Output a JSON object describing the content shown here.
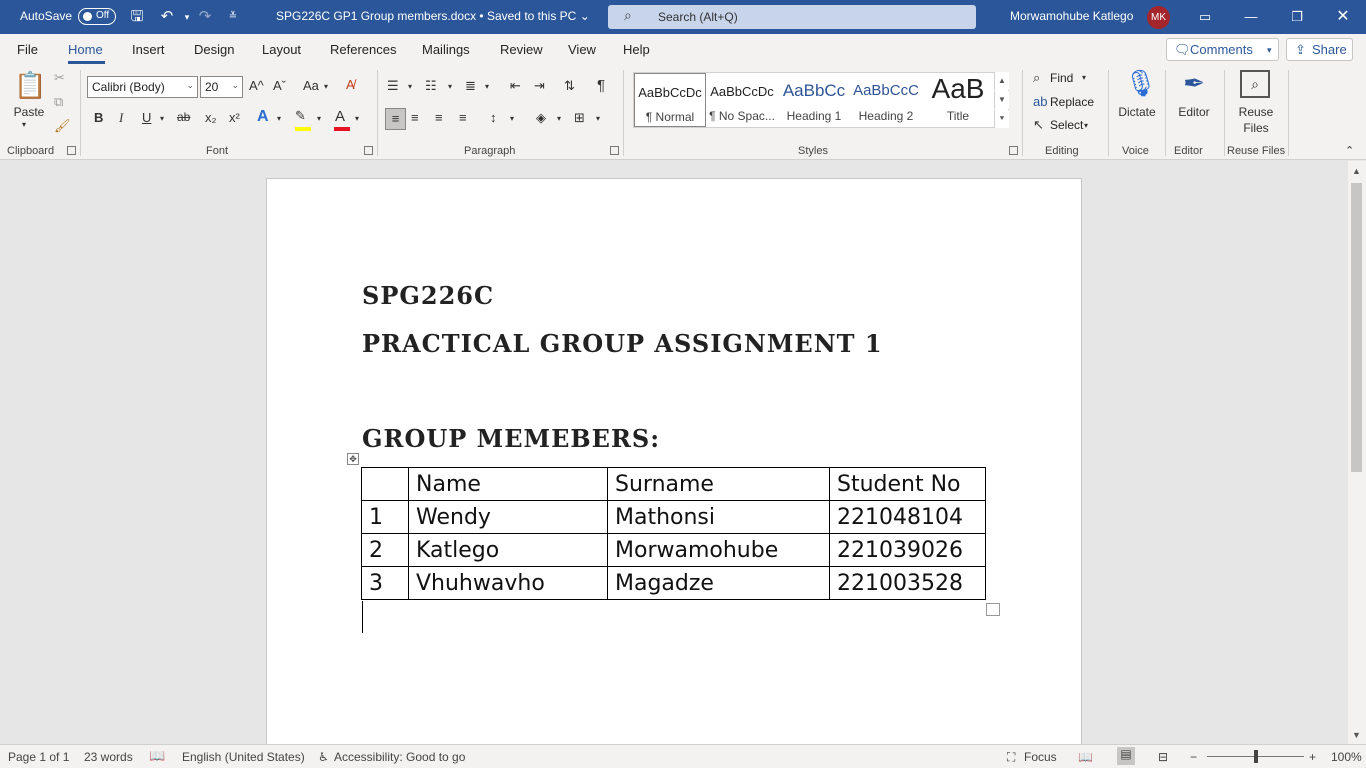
{
  "titlebar": {
    "autosave_label": "AutoSave",
    "autosave_state": "Off",
    "doc_title": "SPG226C GP1 Group members.docx • Saved to this PC",
    "search_placeholder": "Search (Alt+Q)",
    "user_name": "Morwamohube Katlego",
    "user_initials": "MK"
  },
  "menu": {
    "tabs": [
      "File",
      "Home",
      "Insert",
      "Design",
      "Layout",
      "References",
      "Mailings",
      "Review",
      "View",
      "Help"
    ],
    "active_tab": "Home",
    "comments_label": "Comments",
    "share_label": "Share"
  },
  "ribbon": {
    "clipboard": {
      "label": "Clipboard",
      "paste_label": "Paste"
    },
    "font": {
      "label": "Font",
      "font_name": "Calibri (Body)",
      "font_size": "20",
      "bold": "B",
      "italic": "I",
      "underline": "U",
      "strike": "ab",
      "subscript": "x₂",
      "superscript": "x²",
      "change_case": "Aa",
      "grow": "A^",
      "shrink": "Aˇ",
      "highlight_color": "#ffff00",
      "font_color": "#e81123"
    },
    "paragraph": {
      "label": "Paragraph"
    },
    "styles": {
      "label": "Styles",
      "items": [
        {
          "preview": "AaBbCcDc",
          "name": "¶ Normal"
        },
        {
          "preview": "AaBbCcDc",
          "name": "¶ No Spac..."
        },
        {
          "preview": "AaBbCc",
          "name": "Heading 1"
        },
        {
          "preview": "AaBbCcC",
          "name": "Heading 2"
        },
        {
          "preview": "AaB",
          "name": "Title"
        }
      ]
    },
    "editing": {
      "label": "Editing",
      "find": "Find",
      "replace": "Replace",
      "select": "Select"
    },
    "voice": {
      "label": "Voice",
      "dictate": "Dictate"
    },
    "editor": {
      "label": "Editor",
      "editor": "Editor"
    },
    "reuse": {
      "label": "Reuse Files",
      "reuse_line1": "Reuse",
      "reuse_line2": "Files"
    }
  },
  "document": {
    "line1": "SPG226C",
    "line2": "PRACTICAL GROUP ASSIGNMENT 1",
    "line3": "GROUP MEMEBERS:",
    "table": {
      "headers": [
        "",
        "Name",
        "Surname",
        "Student No"
      ],
      "rows": [
        [
          "1",
          "Wendy",
          "Mathonsi",
          "221048104"
        ],
        [
          "2",
          "Katlego",
          "Morwamohube",
          "221039026"
        ],
        [
          "3",
          "Vhuhwavho",
          "Magadze",
          "221003528"
        ]
      ]
    }
  },
  "status": {
    "page": "Page 1 of 1",
    "words": "23 words",
    "language": "English (United States)",
    "accessibility": "Accessibility: Good to go",
    "focus": "Focus",
    "zoom": "100%",
    "zoom_fraction": 0.5
  },
  "colors": {
    "titlebar_bg": "#2b579a",
    "accent": "#2b579a",
    "avatar_bg": "#a4262c"
  }
}
